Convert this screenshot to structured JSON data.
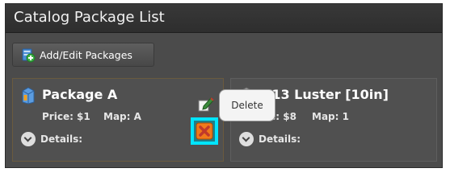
{
  "window": {
    "title": "Catalog Package List"
  },
  "toolbar": {
    "add_edit_label": "Add/Edit Packages",
    "add_icon": "package-add-icon"
  },
  "packages": [
    {
      "name": "Package A",
      "price": "Price: $1",
      "map": "Map: A",
      "details_label": "Details:",
      "icon": "package-icon",
      "actions": {
        "edit_icon": "edit-icon",
        "delete_icon": "delete-icon"
      }
    },
    {
      "name": "x13 Luster [10in]",
      "price": "ce: $8",
      "map": "Map: 1",
      "details_label": "Details:",
      "icon": "package-icon"
    }
  ],
  "tooltip": {
    "text": "Delete"
  },
  "colors": {
    "window_bg": "#4b4b4b",
    "title_bar": "#333333",
    "card_bg": "#505050",
    "selected_card_border": "#6a5a3e",
    "highlight": "#00e5ff",
    "delete_orange": "#f07a1a",
    "tooltip_bg": "#f4f4f4"
  }
}
